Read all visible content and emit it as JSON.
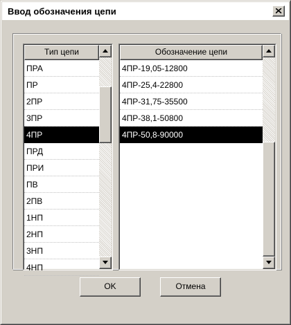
{
  "window": {
    "title": "Ввод обозначения цепи",
    "close_symbol": "×"
  },
  "chain_type_list": {
    "header": "Тип цепи",
    "items": [
      "ПРА",
      "ПР",
      "2ПР",
      "3ПР",
      "4ПР",
      "ПРД",
      "ПРИ",
      "ПВ",
      "2ПВ",
      "1НП",
      "2НП",
      "3НП",
      "4НП"
    ],
    "selected_index": 4
  },
  "chain_designation_list": {
    "header": "Обозначение цепи",
    "items": [
      "4ПР-19,05-12800",
      "4ПР-25,4-22800",
      "4ПР-31,75-35500",
      "4ПР-38,1-50800",
      "4ПР-50,8-90000"
    ],
    "selected_index": 4
  },
  "buttons": {
    "ok": "OK",
    "cancel": "Отмена"
  },
  "icons": {
    "close": "close-icon",
    "scroll_up": "arrow-up-icon",
    "scroll_down": "arrow-down-icon"
  },
  "colors": {
    "face": "#d4d0c8",
    "selection": "#000000",
    "selection_text": "#ffffff"
  }
}
